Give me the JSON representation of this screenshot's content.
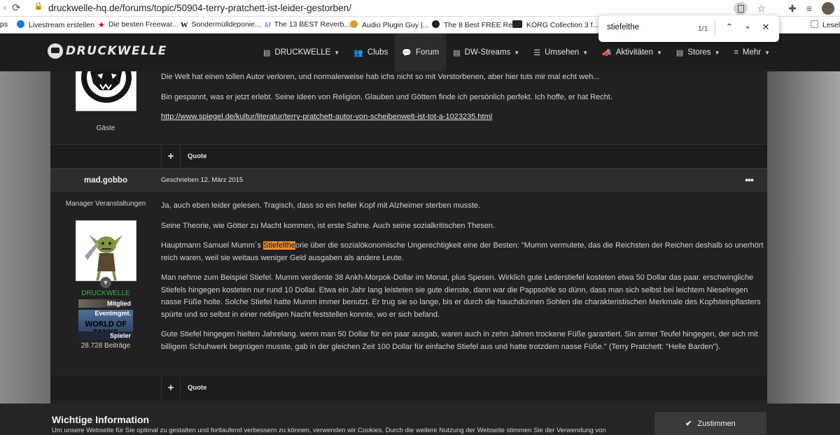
{
  "browser": {
    "url": "druckwelle-hq.de/forums/topic/50904-terry-pratchett-ist-leider-gestorben/",
    "bookmarks": [
      {
        "label": "ps",
        "icon": "none"
      },
      {
        "label": "Livestream erstellen",
        "icon": "facebook-icon"
      },
      {
        "label": "Die besten Freewar...",
        "icon": "star-icon"
      },
      {
        "label": "Sondermülldeponie...",
        "icon": "w-icon"
      },
      {
        "label": "The 13 BEST Reverb...",
        "icon": "m-icon"
      },
      {
        "label": "Audio Plugin Guy |...",
        "icon": "plugin-icon"
      },
      {
        "label": "The 8 Best FREE Re...",
        "icon": "black-circle-icon"
      },
      {
        "label": "KORG Collection 3 f...",
        "icon": "korg-icon"
      },
      {
        "label": "Leseli",
        "icon": "page-icon"
      }
    ],
    "find": {
      "query": "stiefelthe",
      "count": "1/1"
    }
  },
  "site": {
    "logo_text": "DRUCKWELLE",
    "nav": [
      {
        "label": "DRUCKWELLE",
        "icon": "document-icon",
        "caret": true,
        "active": false
      },
      {
        "label": "Clubs",
        "icon": "users-icon",
        "caret": false,
        "active": false
      },
      {
        "label": "Forum",
        "icon": "comments-icon",
        "caret": false,
        "active": true
      },
      {
        "label": "DW-Streams",
        "icon": "document-icon",
        "caret": true,
        "active": false
      },
      {
        "label": "Umsehen",
        "icon": "list-icon",
        "caret": true,
        "active": false
      },
      {
        "label": "Aktivitäten",
        "icon": "megaphone-icon",
        "caret": true,
        "active": false
      },
      {
        "label": "Stores",
        "icon": "document-icon",
        "caret": true,
        "active": false
      },
      {
        "label": "Mehr",
        "icon": "bars-icon",
        "caret": true,
        "active": false
      }
    ]
  },
  "post1": {
    "author_group": "Gäste",
    "paragraphs": [
      "Die Welt hat einen tollen Autor verloren, und normalerweise hab ichs nicht so mit Verstorbenen, aber hier tuts mir mal echt weh...",
      "Bin gespannt, was er jetzt erlebt. Seine Ideen von Religion, Glauben und Göttern finde ich persönlich perfekt. Ich hoffe, er hat Recht."
    ],
    "link": "http://www.spiegel.de/kultur/literatur/terry-pratchett-autor-von-scheibenwelt-ist-tot-a-1023235.html",
    "quote_label": "Quote",
    "plus_label": "+"
  },
  "post2": {
    "author": "mad.gobbo",
    "date": "Geschrieben 12. März 2015",
    "menu": "•••",
    "role": "Manager Veranstaltungen",
    "group": "DRUCKWELLE",
    "rank": "Mitglied",
    "badge_top": "Eventmgmt.",
    "badge_game": "WORLD OF TANKS",
    "badge_bottom": "Spieler",
    "post_count": "28.728 Beiträge",
    "p1": "Ja, auch eben leider gelesen. Tragisch, dass so ein heller Kopf mit Alzheimer sterben musste.",
    "p2": "Seine Theorie, wie Götter zu Macht kommen, ist erste Sahne. Auch seine sozialkritischen Thesen.",
    "p3_before": "Hauptmann Samuel Mumm´s ",
    "p3_mark": "Stiefelthe",
    "p3_after": "orie über die sozialökonomische Ungerechtigkeit eine der Besten: \"Mumm vermutete, das die Reichsten der Reichen deshalb so unerhört reich waren, weil sie weitaus weniger Geld ausgaben als andere Leute.",
    "p4": "Man nehme zum Beispiel Stiefel. Mumm verdiente 38 Ankh-Morpok-Dollar im Monat, plus Spesen. Wirklich gute Lederstiefel kosteten etwa 50 Dollar das paar. erschwingliche Stiefels hingegen kosteten nur rund 10 Dollar. Etwa ein Jahr lang leisteten sie gute dienste, dann war die Pappsohle so dünn, dass man sich selbst bei leichtem Nieselregen nasse Füße holte. Solche Stiefel hatte Mumm immer benutzt. Er trug sie so lange, bis er durch die hauchdünnen Sohlen die charakteristischen Merkmale des Kopfsteinpflasters spürte und so selbst in einer nebligen Nacht feststellen konnte, wo er sich befand.",
    "p5": "Gute Stiefel hingegen hielten Jahrelang. wenn man 50 Dollar für ein paar ausgab, waren auch in zehn Jahren trockene Füße garantiert. Sin armer Teufel hingegen, der sich mit billigem Schuhwerk begnügen musste, gab in der gleichen Zeit 100 Dollar für einfache Stiefel aus und hatte trotzdem nasse Füße.\" (Terry Pratchett: \"Helle Barden\").",
    "quote_label": "Quote",
    "plus_label": "+"
  },
  "cookie": {
    "title": "Wichtige Information",
    "text": "Um unsere Webseite für Sie optimal zu gestalten und fortlaufend verbessern zu können, verwenden wir Cookies. Durch die weitere Nutzung der Webseite stimmen Sie der Verwendung von",
    "button": "Zustimmen"
  },
  "colors": {
    "highlight": "#f28c28",
    "group_green": "#3fb04a",
    "header_bg": "#1d1d1d"
  }
}
